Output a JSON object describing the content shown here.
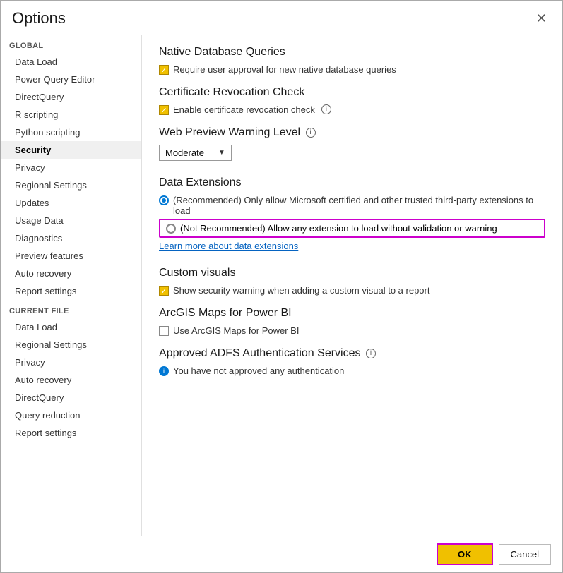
{
  "dialog": {
    "title": "Options",
    "close_label": "✕"
  },
  "sidebar": {
    "global_label": "GLOBAL",
    "global_items": [
      {
        "label": "Data Load",
        "active": false
      },
      {
        "label": "Power Query Editor",
        "active": false
      },
      {
        "label": "DirectQuery",
        "active": false
      },
      {
        "label": "R scripting",
        "active": false
      },
      {
        "label": "Python scripting",
        "active": false
      },
      {
        "label": "Security",
        "active": true
      },
      {
        "label": "Privacy",
        "active": false
      },
      {
        "label": "Regional Settings",
        "active": false
      },
      {
        "label": "Updates",
        "active": false
      },
      {
        "label": "Usage Data",
        "active": false
      },
      {
        "label": "Diagnostics",
        "active": false
      },
      {
        "label": "Preview features",
        "active": false
      },
      {
        "label": "Auto recovery",
        "active": false
      },
      {
        "label": "Report settings",
        "active": false
      }
    ],
    "current_file_label": "CURRENT FILE",
    "current_file_items": [
      {
        "label": "Data Load",
        "active": false
      },
      {
        "label": "Regional Settings",
        "active": false
      },
      {
        "label": "Privacy",
        "active": false
      },
      {
        "label": "Auto recovery",
        "active": false
      },
      {
        "label": "DirectQuery",
        "active": false
      },
      {
        "label": "Query reduction",
        "active": false
      },
      {
        "label": "Report settings",
        "active": false
      }
    ]
  },
  "content": {
    "sections": [
      {
        "id": "native-db",
        "title": "Native Database Queries",
        "items": [
          {
            "type": "checkbox-checked",
            "label": "Require user approval for new native database queries"
          }
        ]
      },
      {
        "id": "cert-revocation",
        "title": "Certificate Revocation Check",
        "items": [
          {
            "type": "checkbox-checked",
            "label": "Enable certificate revocation check",
            "info": true
          }
        ]
      },
      {
        "id": "web-preview",
        "title": "Web Preview Warning Level",
        "info": true,
        "dropdown": {
          "value": "Moderate"
        }
      },
      {
        "id": "data-extensions",
        "title": "Data Extensions",
        "radios": [
          {
            "type": "radio-checked",
            "label": "(Recommended) Only allow Microsoft certified and other trusted third-party extensions to load",
            "highlighted": false
          },
          {
            "type": "radio-unchecked",
            "label": "(Not Recommended) Allow any extension to load without validation or warning",
            "highlighted": true
          }
        ],
        "link": "Learn more about data extensions"
      },
      {
        "id": "custom-visuals",
        "title": "Custom visuals",
        "items": [
          {
            "type": "checkbox-checked",
            "label": "Show security warning when adding a custom visual to a report"
          }
        ]
      },
      {
        "id": "arcgis",
        "title": "ArcGIS Maps for Power BI",
        "items": [
          {
            "type": "checkbox-unchecked",
            "label": "Use ArcGIS Maps for Power BI"
          }
        ]
      },
      {
        "id": "adfs",
        "title": "Approved ADFS Authentication Services",
        "info": true,
        "info_row": {
          "label": "You have not approved any authentication"
        }
      }
    ]
  },
  "footer": {
    "ok_label": "OK",
    "cancel_label": "Cancel"
  }
}
